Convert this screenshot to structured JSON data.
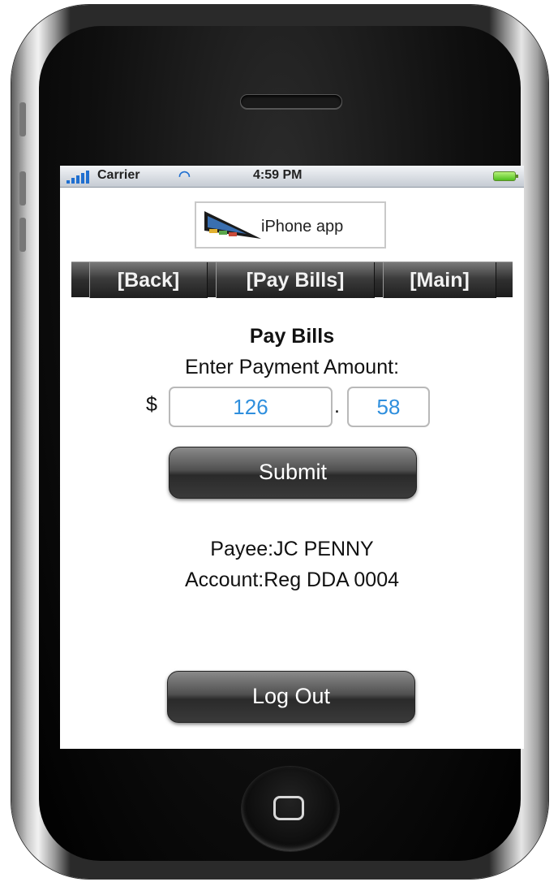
{
  "status_bar": {
    "carrier": "Carrier",
    "time": "4:59 PM"
  },
  "logo": {
    "text": "iPhone app"
  },
  "nav": {
    "back": "[Back]",
    "pay_bills": "[Pay Bills]",
    "main": "[Main]"
  },
  "content": {
    "title": "Pay Bills",
    "instruction": "Enter Payment Amount:",
    "currency_symbol": "$",
    "decimal_point": ".",
    "dollars_value": "126",
    "cents_value": "58",
    "submit_label": "Submit",
    "payee": "Payee:JC PENNY",
    "account": "Account:Reg DDA 0004",
    "logout_label": "Log Out"
  },
  "colors": {
    "input_text": "#2f8fdd",
    "status_accent": "#1f6fd0",
    "battery": "#4fbf1e"
  },
  "icons": [
    "signal-icon",
    "wifi-icon",
    "battery-icon",
    "home-icon"
  ]
}
